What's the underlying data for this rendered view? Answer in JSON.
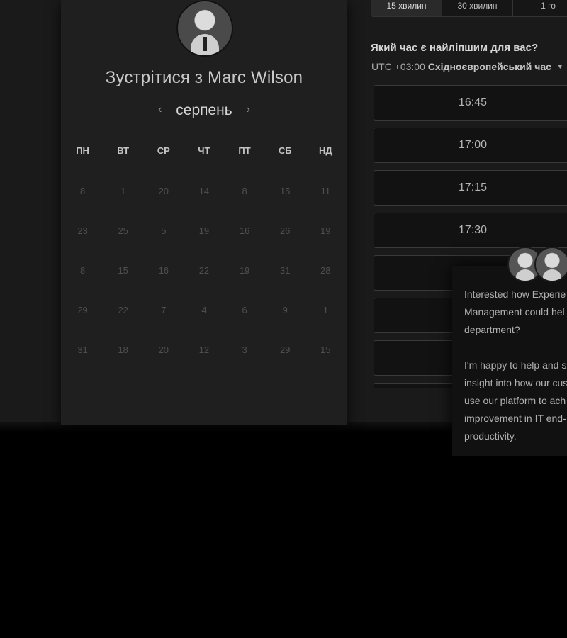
{
  "calendar": {
    "title": "Зустрітися з Marc Wilson",
    "month": "серпень",
    "prev_icon": "chevron-left-icon",
    "next_icon": "chevron-right-icon",
    "weekdays": [
      "ПН",
      "ВТ",
      "СР",
      "ЧТ",
      "ПТ",
      "СБ",
      "НД"
    ],
    "weeks": [
      [
        "8",
        "1",
        "20",
        "14",
        "8",
        "15",
        "11"
      ],
      [
        "23",
        "25",
        "5",
        "19",
        "16",
        "26",
        "19"
      ],
      [
        "8",
        "15",
        "16",
        "22",
        "19",
        "31",
        "28"
      ],
      [
        "29",
        "22",
        "7",
        "4",
        "6",
        "9",
        "1"
      ],
      [
        "31",
        "18",
        "20",
        "12",
        "3",
        "29",
        "15"
      ]
    ]
  },
  "durations": [
    "15 хвилин",
    "30 хвилин",
    "1 го"
  ],
  "time_picker": {
    "heading": "Який час є найліпшим для вас?",
    "tz_offset": "UTC +03:00",
    "tz_name": "Східноєвропейський час",
    "slots": [
      "16:45",
      "17:00",
      "17:15",
      "17:30",
      "",
      "",
      "",
      ""
    ]
  },
  "chat": {
    "lines_1": [
      "Interested how Experie",
      "Management could hel",
      "department?"
    ],
    "lines_2": [
      "I'm happy to help and s",
      "insight into how our cus",
      "use our platform to ach",
      "improvement in IT end-",
      "productivity."
    ]
  },
  "colors": {
    "background": "#000000",
    "card": "#1f1f1f",
    "slot_border": "#3a3a3a"
  }
}
